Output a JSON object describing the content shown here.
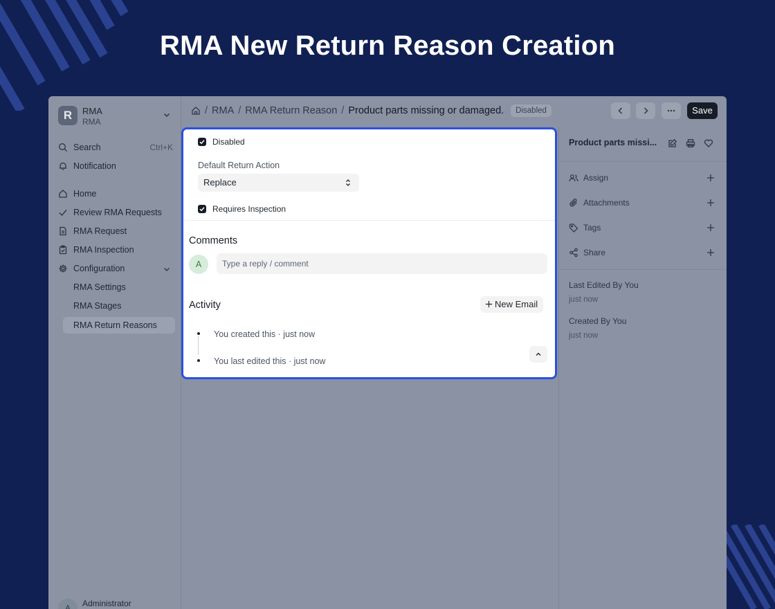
{
  "headline": "RMA New Return Reason Creation",
  "workspace": {
    "logo_letter": "R",
    "title": "RMA",
    "subtitle": "RMA"
  },
  "sidebar": {
    "search": {
      "label": "Search",
      "shortcut": "Ctrl+K"
    },
    "notification": "Notification",
    "items": [
      {
        "label": "Home",
        "icon": "home-icon"
      },
      {
        "label": "Review RMA Requests",
        "icon": "check-icon"
      },
      {
        "label": "RMA Request",
        "icon": "file-icon"
      },
      {
        "label": "RMA Inspection",
        "icon": "clipboard-icon"
      },
      {
        "label": "Configuration",
        "icon": "gear-icon"
      }
    ],
    "sub_items": [
      {
        "label": "RMA Settings"
      },
      {
        "label": "RMA Stages"
      },
      {
        "label": "RMA Return Reasons"
      }
    ],
    "user": {
      "initial": "A",
      "name": "Administrator"
    }
  },
  "breadcrumb": {
    "items": [
      "RMA",
      "RMA Return Reason"
    ],
    "current": "Product parts missing or damaged.",
    "status_badge": "Disabled"
  },
  "toolbar": {
    "save_label": "Save",
    "more_label": "···"
  },
  "form": {
    "disabled_label": "Disabled",
    "disabled_checked": true,
    "default_action_label": "Default Return Action",
    "default_action_value": "Replace",
    "requires_inspection_label": "Requires Inspection",
    "requires_inspection_checked": true
  },
  "comments": {
    "title": "Comments",
    "avatar_initial": "A",
    "placeholder": "Type a reply / comment"
  },
  "activity": {
    "title": "Activity",
    "new_email_label": "New Email",
    "entries": [
      {
        "text": "You created this · just now"
      },
      {
        "text": "You last edited this · just now"
      }
    ]
  },
  "right_sidebar": {
    "title": "Product parts missi...",
    "actions": [
      {
        "label": "Assign",
        "icon": "users-icon"
      },
      {
        "label": "Attachments",
        "icon": "paperclip-icon"
      },
      {
        "label": "Tags",
        "icon": "tag-icon"
      },
      {
        "label": "Share",
        "icon": "share-icon"
      }
    ],
    "last_edited_label": "Last Edited By You",
    "last_edited_time": "just now",
    "created_label": "Created By You",
    "created_time": "just now"
  }
}
